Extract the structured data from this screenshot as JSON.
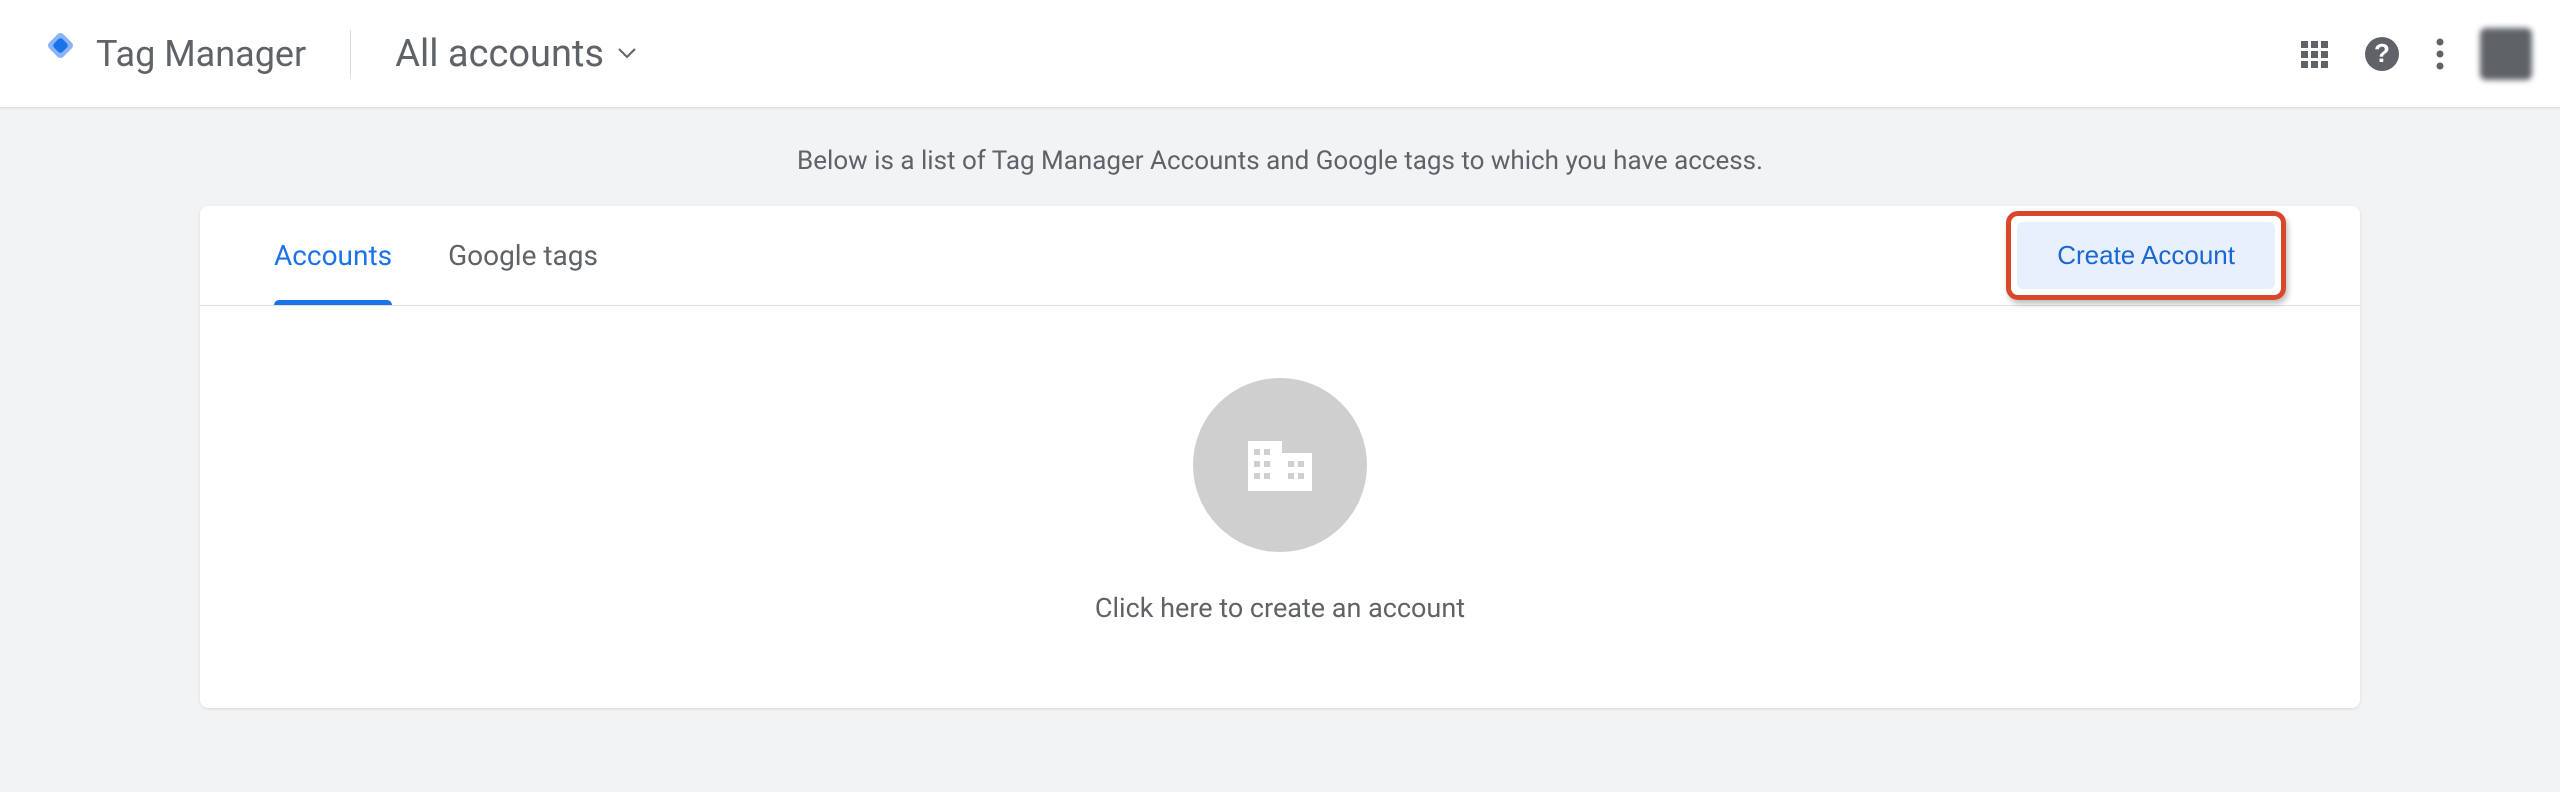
{
  "header": {
    "product_name": "Tag Manager",
    "account_selector_label": "All accounts"
  },
  "main": {
    "subtitle": "Below is a list of Tag Manager Accounts and Google tags to which you have access.",
    "tabs": [
      {
        "label": "Accounts",
        "active": true
      },
      {
        "label": "Google tags",
        "active": false
      }
    ],
    "create_button_label": "Create Account",
    "empty_state_text": "Click here to create an account"
  },
  "colors": {
    "primary_blue": "#1a73e8",
    "highlight_red": "#d9472b",
    "text_gray": "#5f6368"
  }
}
